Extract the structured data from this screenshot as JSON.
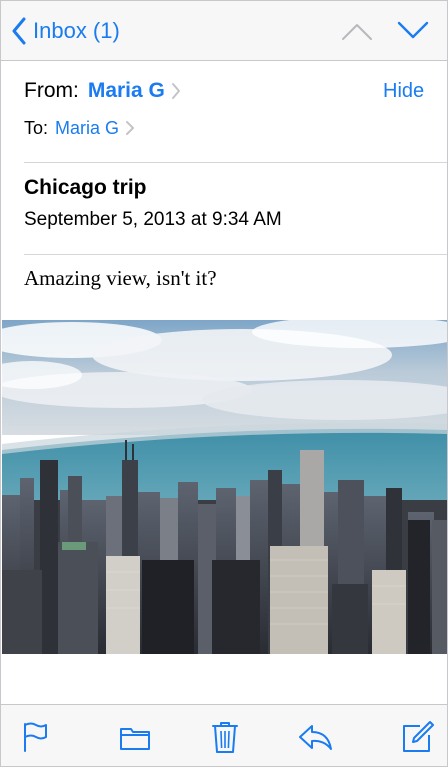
{
  "nav": {
    "back_label": "Inbox (1)"
  },
  "header": {
    "from_label": "From:",
    "from_name": "Maria G",
    "hide_label": "Hide",
    "to_label": "To:",
    "to_name": "Maria G"
  },
  "message": {
    "subject": "Chicago trip",
    "date": "September 5, 2013 at 9:34 AM",
    "body": "Amazing view, isn't it?"
  },
  "attachment": {
    "icon": "city-skyline-photo"
  },
  "toolbar": {
    "icons": [
      "flag-icon",
      "folder-icon",
      "trash-icon",
      "reply-icon",
      "compose-icon"
    ]
  },
  "colors": {
    "accent": "#1a7cf0",
    "bar_background": "#f7f7f7",
    "separator": "#c8c8cc"
  }
}
